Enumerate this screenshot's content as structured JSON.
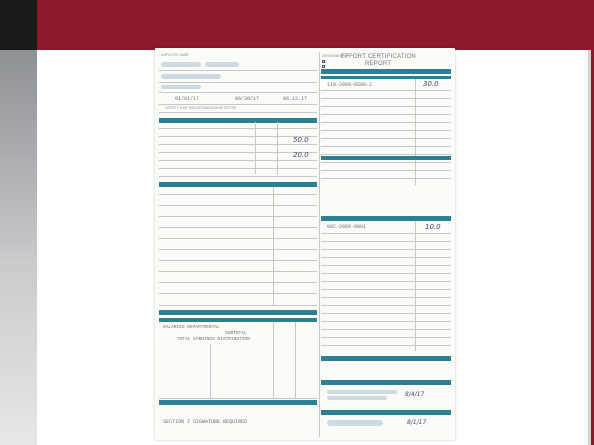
{
  "slide": {
    "header_color": "#8c1a2c"
  },
  "document": {
    "title_line1": "EFFORT CERTIFICATION",
    "title_line2": "REPORT",
    "dates": {
      "from": "01/01/17",
      "to": "06/30/17",
      "issued": "06.12.17"
    },
    "section_right_top": {
      "account": "119-2069-0509-2",
      "percent": "30.0"
    },
    "section_left_mid": {
      "value_a": "50.0",
      "value_b": "20.0"
    },
    "section_right_mid": {
      "account": "06C-2069-0001",
      "percent": "10.0"
    },
    "subtotal_line1": "SALARIES DEPARTMENTAL",
    "subtotal_line2": "SUBTOTAL",
    "subtotal_line3": "TOTAL EARNINGS DISTRIBUTION",
    "signature_date_1": "8/4/17",
    "signature_date_2": "8/1/17",
    "footer_text": "SECTION I   SIGNATURE REQUIRED"
  }
}
